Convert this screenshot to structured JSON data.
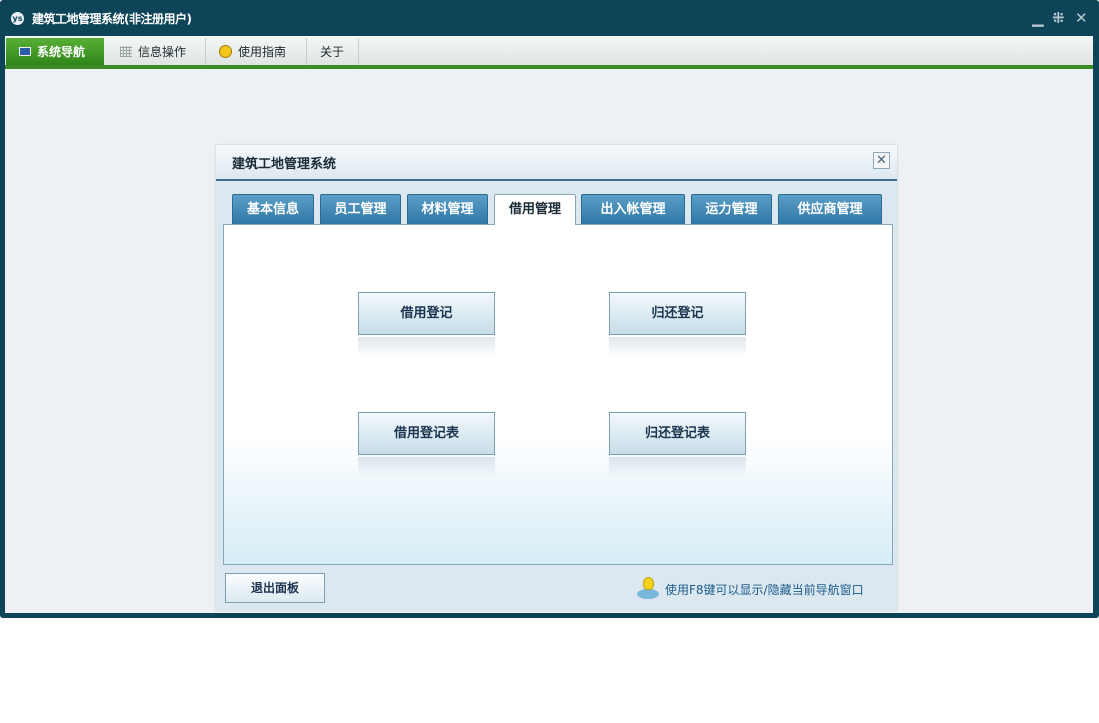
{
  "window": {
    "title": "建筑工地管理系统(非注册用户)",
    "logo_glyph": "ys",
    "controls": {
      "minimize": "▁",
      "restore": "⁜",
      "close": "✕"
    }
  },
  "menubar": {
    "items": [
      {
        "label": "系统导航",
        "icon": "monitor-icon",
        "active": true
      },
      {
        "label": "信息操作",
        "icon": "grid-icon",
        "active": false
      },
      {
        "label": "使用指南",
        "icon": "bulb-icon",
        "active": false
      },
      {
        "label": "关于",
        "icon": "",
        "active": false
      }
    ]
  },
  "panel": {
    "title": "建筑工地管理系统",
    "close_glyph": "✕",
    "tabs": [
      {
        "label": "基本信息",
        "active": false
      },
      {
        "label": "员工管理",
        "active": false
      },
      {
        "label": "材料管理",
        "active": false
      },
      {
        "label": "借用管理",
        "active": true
      },
      {
        "label": "出入帐管理",
        "active": false
      },
      {
        "label": "运力管理",
        "active": false
      },
      {
        "label": "供应商管理",
        "active": false
      }
    ],
    "buttons": {
      "borrow_register": "借用登记",
      "return_register": "归还登记",
      "borrow_register_table": "借用登记表",
      "return_register_table": "归还登记表"
    },
    "exit_button": "退出面板",
    "hint": "使用F8键可以显示/隐藏当前导航窗口"
  },
  "colors": {
    "title_bar": "#0e4458",
    "menu_accent": "#3c8c26",
    "tab_blue": "#2f77a6",
    "hint_text": "#1d5b8d"
  }
}
